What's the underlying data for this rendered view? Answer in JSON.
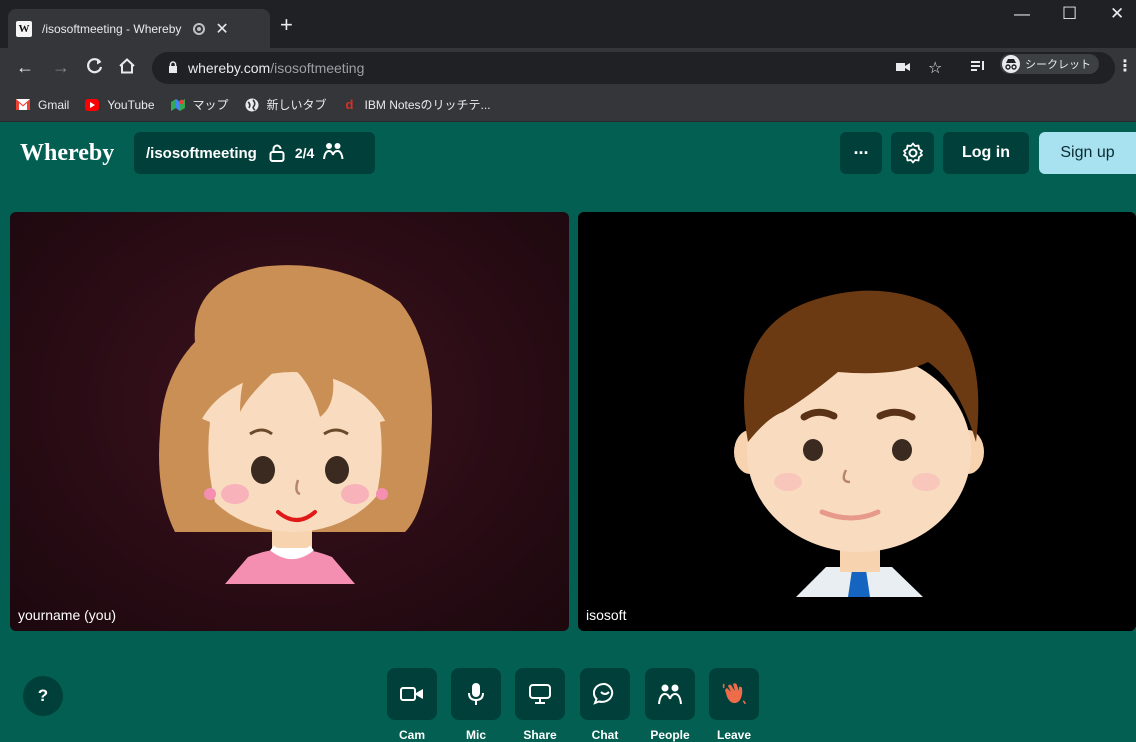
{
  "browser": {
    "tab_title": "/isosoftmeeting - Whereby",
    "tab_favicon": "W",
    "url_host": "whereby.com",
    "url_path": "/isosoftmeeting",
    "incognito_label": "シークレット",
    "bookmarks": [
      {
        "label": "Gmail",
        "icon": "gmail-icon",
        "color": "#ea4335"
      },
      {
        "label": "YouTube",
        "icon": "youtube-icon",
        "color": "#ff0000"
      },
      {
        "label": "マップ",
        "icon": "maps-icon",
        "color": "#34a853"
      },
      {
        "label": "新しいタブ",
        "icon": "globe-icon",
        "color": "#e8eaed"
      },
      {
        "label": "IBM Notesのリッチテ...",
        "icon": "notes-icon",
        "color": "#d93025"
      }
    ]
  },
  "app": {
    "logo": "Whereby",
    "room_name": "/isosoftmeeting",
    "participant_count": "2/4",
    "login_label": "Log in",
    "signup_label": "Sign up",
    "more_label": "···",
    "help_label": "?",
    "accent_color": "#035f52",
    "dark_color": "#01403a",
    "signup_color": "#a8e2f0"
  },
  "participants": [
    {
      "name": "yourname (you)",
      "avatar": "girl-avatar"
    },
    {
      "name": "isosoft",
      "avatar": "boy-avatar"
    }
  ],
  "controls": [
    {
      "label": "Cam",
      "icon": "camera-icon"
    },
    {
      "label": "Mic",
      "icon": "microphone-icon"
    },
    {
      "label": "Share",
      "icon": "screen-share-icon"
    },
    {
      "label": "Chat",
      "icon": "chat-icon"
    },
    {
      "label": "People",
      "icon": "people-icon"
    },
    {
      "label": "Leave",
      "icon": "waving-hand-icon"
    }
  ]
}
